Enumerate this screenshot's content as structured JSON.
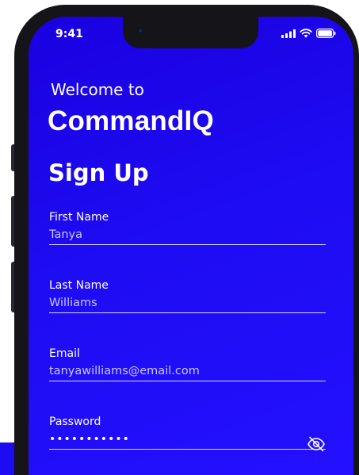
{
  "status_bar": {
    "time": "9:41",
    "icons": [
      "signal-icon",
      "wifi-icon",
      "battery-icon"
    ]
  },
  "header": {
    "welcome": "Welcome to",
    "brand": "CommandIQ",
    "title": "Sign Up"
  },
  "form": {
    "first_name": {
      "label": "First Name",
      "value": "Tanya"
    },
    "last_name": {
      "label": "Last Name",
      "value": "Williams"
    },
    "email": {
      "label": "Email",
      "value": "tanyawilliams@email.com"
    },
    "password": {
      "label": "Password",
      "masked_value": "•••••••••••",
      "toggle_icon": "eye-off-icon"
    }
  },
  "colors": {
    "screen_background": "#1e0cf2",
    "text": "#ffffff",
    "input_text": "#c9c6ff",
    "device_frame": "#151419"
  }
}
